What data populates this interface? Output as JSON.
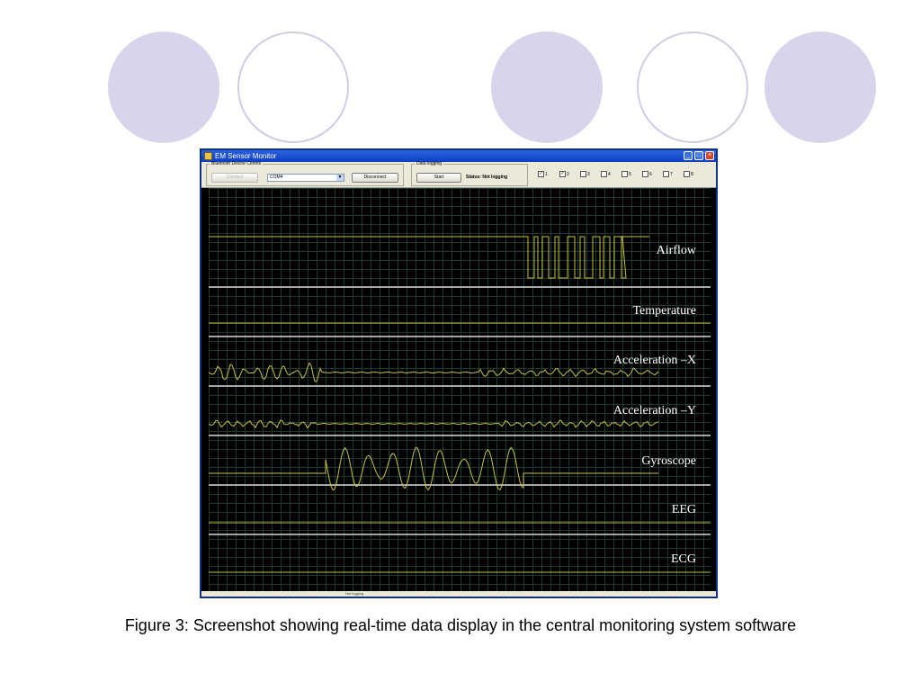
{
  "window": {
    "title": "EM Sensor Monitor",
    "min_glyph": "_",
    "max_glyph": "□",
    "close_glyph": "×"
  },
  "bluetooth_group": {
    "legend": "Bluetooth Device Control",
    "connect_label": "Connect",
    "port_value": "COM4",
    "disconnect_label": "Disconnect"
  },
  "logging_group": {
    "legend": "Data logging",
    "start_label": "Start",
    "status_text": "Status: Not logging"
  },
  "channels": [
    {
      "label": "1",
      "checked": true
    },
    {
      "label": "2",
      "checked": true
    },
    {
      "label": "3",
      "checked": false
    },
    {
      "label": "4",
      "checked": false
    },
    {
      "label": "5",
      "checked": false
    },
    {
      "label": "6",
      "checked": false
    },
    {
      "label": "7",
      "checked": false
    },
    {
      "label": "8",
      "checked": false
    }
  ],
  "traces": [
    "Airflow",
    "Temperature",
    "Acceleration –X",
    "Acceleration –Y",
    "Gyroscope",
    "EEG",
    "ECG"
  ],
  "statusbar": "Not logging",
  "caption": "Figure 3: Screenshot showing real-time data display in the central monitoring system software",
  "colors": {
    "trace": "#c8c23c",
    "divider": "#d8d8d8",
    "background": "#000000"
  }
}
